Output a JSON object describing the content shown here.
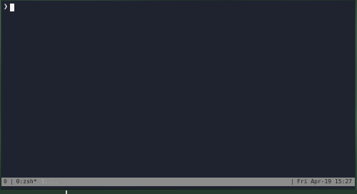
{
  "terminal": {
    "prompt_symbol": "❯",
    "cursor": "block"
  },
  "statusbar": {
    "session": "0",
    "separator": "|",
    "active_window": "0:zsh*",
    "inactive_window": "1:...",
    "datetime": "Fri Apr-19 15:27"
  },
  "colors": {
    "terminal_bg": "#1f2330",
    "statusbar_bg": "#8c8c8c",
    "statusbar_fg": "#202020",
    "wallpaper": "#2b4535"
  }
}
